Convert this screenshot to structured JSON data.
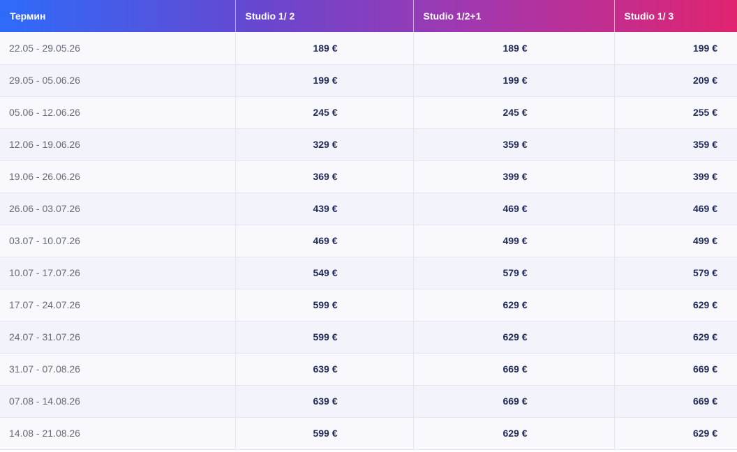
{
  "table": {
    "headers": [
      "Термин",
      "Studio 1/ 2",
      "Studio 1/2+1",
      "Studio 1/ 3"
    ],
    "rows": [
      [
        "22.05 - 29.05.26",
        "189 €",
        "189 €",
        "199 €"
      ],
      [
        "29.05 - 05.06.26",
        "199 €",
        "199 €",
        "209 €"
      ],
      [
        "05.06 - 12.06.26",
        "245 €",
        "245 €",
        "255 €"
      ],
      [
        "12.06 - 19.06.26",
        "329 €",
        "359 €",
        "359 €"
      ],
      [
        "19.06 - 26.06.26",
        "369 €",
        "399 €",
        "399 €"
      ],
      [
        "26.06 - 03.07.26",
        "439 €",
        "469 €",
        "469 €"
      ],
      [
        "03.07 - 10.07.26",
        "469 €",
        "499 €",
        "499 €"
      ],
      [
        "10.07 - 17.07.26",
        "549 €",
        "579 €",
        "579 €"
      ],
      [
        "17.07 - 24.07.26",
        "599 €",
        "629 €",
        "629 €"
      ],
      [
        "24.07 - 31.07.26",
        "599 €",
        "629 €",
        "629 €"
      ],
      [
        "31.07 - 07.08.26",
        "639 €",
        "669 €",
        "669 €"
      ],
      [
        "07.08 - 14.08.26",
        "639 €",
        "669 €",
        "669 €"
      ],
      [
        "14.08 - 21.08.26",
        "599 €",
        "629 €",
        "629 €"
      ]
    ]
  },
  "colors": {
    "header_gradient_start": "#2e6bfa",
    "header_gradient_end": "#e1236f",
    "price_text": "#1f2a57",
    "date_text": "#666a77"
  }
}
